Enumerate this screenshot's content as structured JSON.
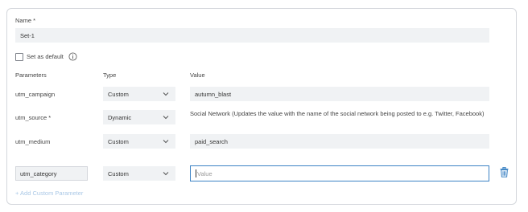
{
  "form": {
    "name_label": "Name *",
    "name_value": "Set-1",
    "default_label": "Set as default",
    "columns": {
      "parameters": "Parameters",
      "type": "Type",
      "value": "Value"
    },
    "rows": [
      {
        "param": "utm_campaign",
        "type": "Custom",
        "value": "autumn_blast"
      },
      {
        "param": "utm_source *",
        "type": "Dynamic",
        "value": "Social Network (Updates the value with the name of the social network being posted to e.g. Twitter, Facebook)"
      },
      {
        "param": "utm_medium",
        "type": "Custom",
        "value": "paid_search"
      }
    ],
    "custom_row": {
      "param": "utm_category",
      "type": "Custom",
      "value_placeholder": "Value"
    },
    "add_link": "+ Add Custom Parameter"
  },
  "icons": {
    "info": "info-icon",
    "chevron": "chevron-down-icon",
    "trash": "trash-icon"
  },
  "colors": {
    "accent": "#3b82c4",
    "field_bg": "#f0f2f4",
    "link": "#aac8e6"
  }
}
